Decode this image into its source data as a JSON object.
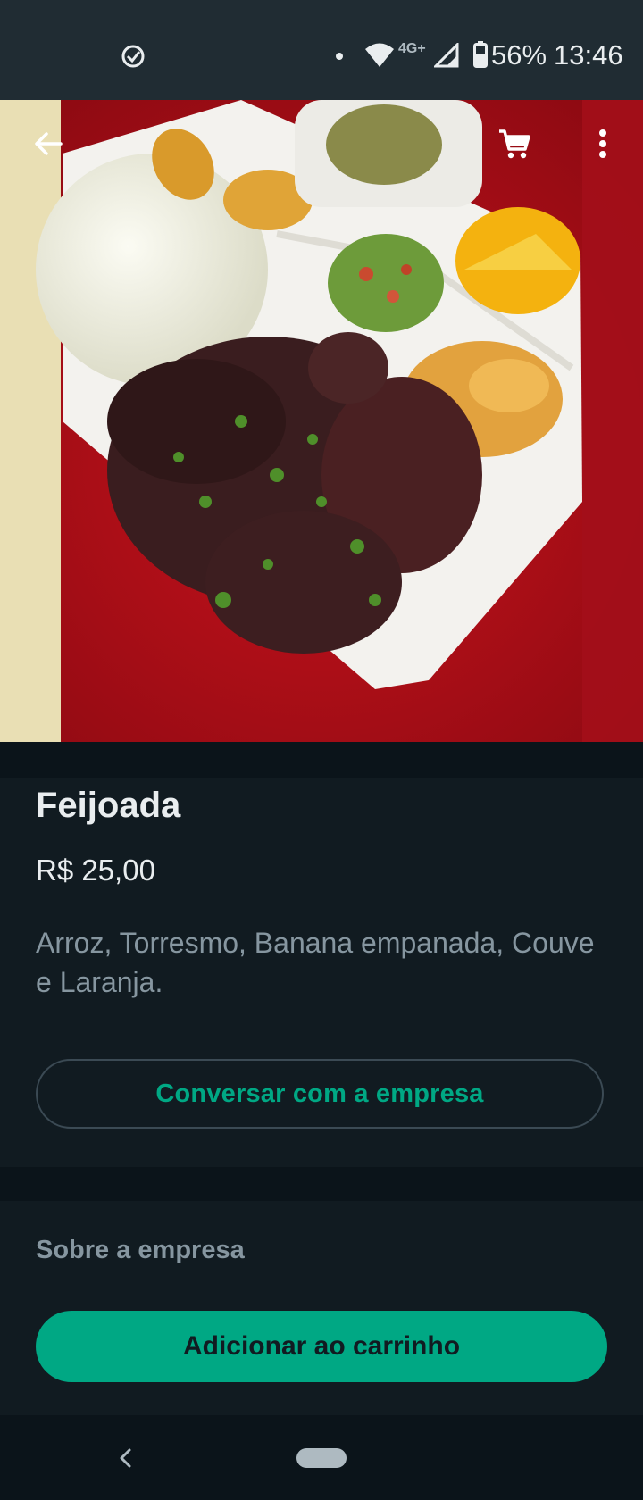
{
  "status_bar": {
    "network": "4G+",
    "battery": "56%",
    "time": "13:46"
  },
  "toolbar": {
    "back_icon": "arrow-back-icon",
    "cart_icon": "shopping-cart-icon",
    "menu_icon": "more-vert-icon"
  },
  "product": {
    "name": "Feijoada",
    "price": "R$ 25,00",
    "description": "Arroz, Torresmo, Banana empanada, Couve e Laranja.",
    "chat_label": "Conversar com a empresa"
  },
  "about": {
    "label": "Sobre a empresa"
  },
  "cta": {
    "add_to_cart_label": "Adicionar ao carrinho"
  },
  "colors": {
    "accent": "#00a884",
    "background": "#111b21",
    "header": "#202c33"
  }
}
